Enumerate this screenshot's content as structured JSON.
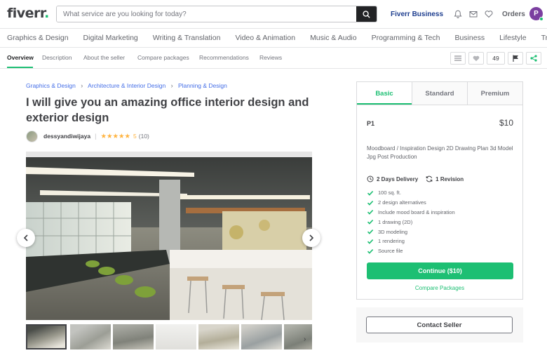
{
  "header": {
    "logo_text": "fiverr",
    "logo_dot": ".",
    "search_placeholder": "What service are you looking for today?",
    "fiverr_business": "Fiverr Business",
    "orders": "Orders",
    "avatar_letter": "P"
  },
  "categories": [
    "Graphics & Design",
    "Digital Marketing",
    "Writing & Translation",
    "Video & Animation",
    "Music & Audio",
    "Programming & Tech",
    "Business",
    "Lifestyle",
    "Trending"
  ],
  "subnav": {
    "tabs": [
      "Overview",
      "Description",
      "About the seller",
      "Compare packages",
      "Recommendations",
      "Reviews"
    ],
    "favorite_count": "49"
  },
  "breadcrumb": [
    "Graphics & Design",
    "Architecture & Interior Design",
    "Planning & Design"
  ],
  "gig": {
    "title": "I will give you an amazing office interior design and exterior design",
    "seller_name": "dessyandiwijaya",
    "stars": "★★★★★",
    "rating": "5",
    "review_count": "(10)"
  },
  "package": {
    "tabs": [
      "Basic",
      "Standard",
      "Premium"
    ],
    "name": "P1",
    "price": "$10",
    "description": "Moodboard / Inspiration Design 2D Drawing Plan 3d Model Jpg Post Production",
    "delivery": "2 Days Delivery",
    "revisions": "1 Revision",
    "features": [
      "100 sq. ft.",
      "2 design alternatives",
      "Include mood board & inspiration",
      "1 drawing (2D)",
      "3D modeling",
      "1 rendering",
      "Source file"
    ],
    "continue_label": "Continue ($10)",
    "compare_label": "Compare Packages"
  },
  "contact_label": "Contact Seller",
  "colors": {
    "brand_green": "#1dbf73",
    "business_blue": "#1e3e8f",
    "link_blue": "#446ee7",
    "star_yellow": "#ffb33e",
    "avatar_purple": "#7b3fa0"
  }
}
